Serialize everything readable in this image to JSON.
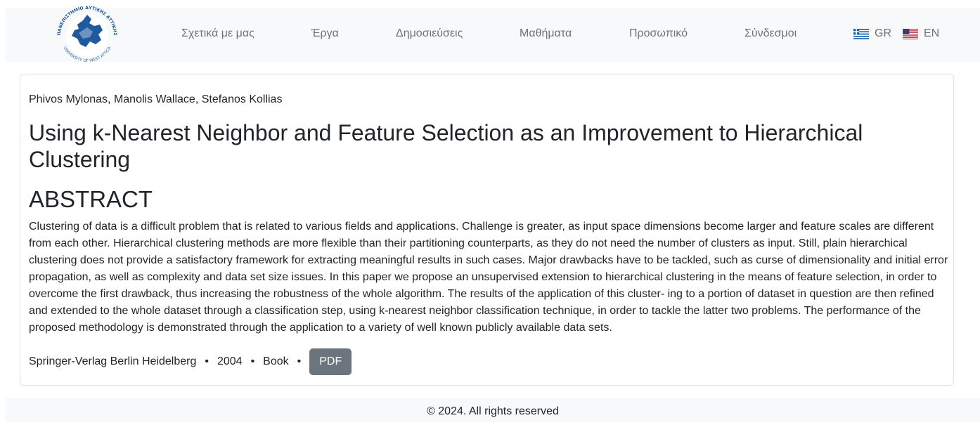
{
  "nav": {
    "items": [
      {
        "label": "Σχετικά με μας"
      },
      {
        "label": "Έργα"
      },
      {
        "label": "Δημοσιεύσεις"
      },
      {
        "label": "Μαθήματα"
      },
      {
        "label": "Προσωπικό"
      },
      {
        "label": "Σύνδεσμοι"
      }
    ],
    "languages": [
      {
        "code": "GR",
        "icon": "greece-flag-icon"
      },
      {
        "code": "EN",
        "icon": "usa-flag-icon"
      }
    ]
  },
  "logo": {
    "text_top": "ΠΑΝΕΠΙΣΤΗΜΙΟ ΔΥΤΙΚΗΣ ΑΤΤΙΚΗΣ",
    "text_bottom": "UNIVERSITY OF WEST ATTICA"
  },
  "publication": {
    "authors": "Phivos Mylonas, Manolis Wallace, Stefanos Kollias",
    "title": "Using k-Nearest Neighbor and Feature Selection as an Improvement to Hierarchical Clustering",
    "abstract_heading": "ABSTRACT",
    "abstract": "Clustering of data is a difficult problem that is related to various fields and applications. Challenge is greater, as input space dimensions become larger and feature scales are different from each other. Hierarchical clustering methods are more flexible than their partitioning counterparts, as they do not need the number of clusters as input. Still, plain hierarchical clustering does not provide a satisfactory framework for extracting meaningful results in such cases. Major drawbacks have to be tackled, such as curse of dimensionality and initial error propagation, as well as complexity and data set size issues. In this paper we propose an unsupervised extension to hierarchical clustering in the means of feature selection, in order to overcome the first drawback, thus increasing the robustness of the whole algorithm. The results of the application of this cluster- ing to a portion of dataset in question are then refined and extended to the whole dataset through a classification step, using k-nearest neighbor classification technique, in order to tackle the latter two problems. The performance of the proposed methodology is demonstrated through the application to a variety of well known publicly available data sets.",
    "publisher": "Springer-Verlag Berlin Heidelberg",
    "year": "2004",
    "type": "Book",
    "separator": "•",
    "pdf_label": "PDF"
  },
  "footer": {
    "text": "© 2024. All rights reserved"
  },
  "colors": {
    "navbar_bg": "#f8f9fa",
    "pdf_button": "#6c757d",
    "logo_blue": "#2a6ab0"
  }
}
